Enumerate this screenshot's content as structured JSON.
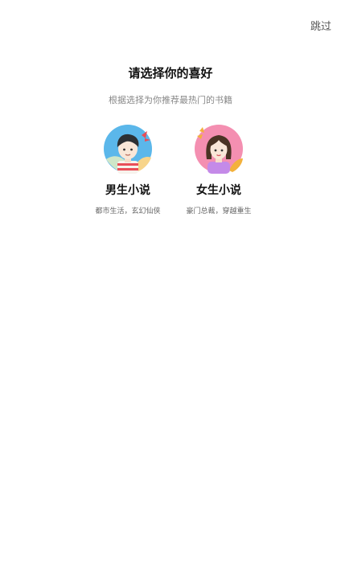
{
  "header": {
    "skip_label": "跳过"
  },
  "main": {
    "title": "请选择你的喜好",
    "subtitle": "根据选择为你推荐最热门的书籍",
    "options": [
      {
        "title": "男生小说",
        "description": "都市生活，玄幻仙侠",
        "icon": "boy-avatar-icon",
        "accent": "#5bb7ea"
      },
      {
        "title": "女生小说",
        "description": "豪门总裁，穿越重生",
        "icon": "girl-avatar-icon",
        "accent": "#f48fb1"
      }
    ]
  }
}
